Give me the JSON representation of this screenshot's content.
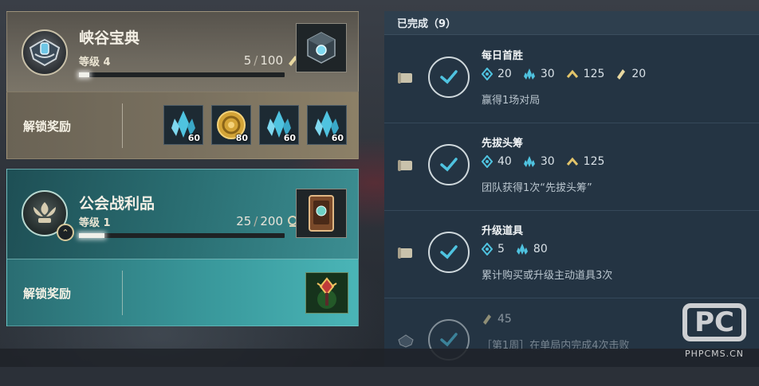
{
  "pass1": {
    "title": "峡谷宝典",
    "level": "等级 4",
    "progress_current": "5",
    "progress_sep": "/",
    "progress_total": "100",
    "progress_fraction": 0.05,
    "unlock_label": "解锁奖励",
    "rewards": [
      {
        "icon": "crystal-icon",
        "qty": "60"
      },
      {
        "icon": "gold-coin-icon",
        "qty": "80"
      },
      {
        "icon": "crystal-icon",
        "qty": "60"
      },
      {
        "icon": "crystal-icon",
        "qty": "60"
      }
    ]
  },
  "pass2": {
    "title": "公会战利品",
    "level": "等级 1",
    "progress_current": "25",
    "progress_sep": "/",
    "progress_total": "200",
    "progress_fraction": 0.125,
    "unlock_label": "解锁奖励"
  },
  "completed": {
    "header": "已完成（9）",
    "missions": [
      {
        "title": "每日首胜",
        "rewards": [
          {
            "icon": "blue-gem-icon",
            "value": "20"
          },
          {
            "icon": "blue-crystal-icon",
            "value": "30"
          },
          {
            "icon": "gold-chevron-icon",
            "value": "125"
          },
          {
            "icon": "gold-ticket-icon",
            "value": "20"
          }
        ],
        "desc": "赢得1场对局"
      },
      {
        "title": "先拔头筹",
        "rewards": [
          {
            "icon": "blue-gem-icon",
            "value": "40"
          },
          {
            "icon": "blue-crystal-icon",
            "value": "30"
          },
          {
            "icon": "gold-chevron-icon",
            "value": "125"
          }
        ],
        "desc": "团队获得1次“先拔头筹”"
      },
      {
        "title": "升级道具",
        "rewards": [
          {
            "icon": "blue-gem-icon",
            "value": "5"
          },
          {
            "icon": "blue-crystal-icon",
            "value": "80"
          }
        ],
        "desc": "累计购买或升级主动道具3次"
      },
      {
        "title": "",
        "rewards": [
          {
            "icon": "gold-ticket-icon",
            "value": "45"
          }
        ],
        "desc": "［第1周］在单局内完成4次击败"
      }
    ]
  },
  "watermark": {
    "logo": "PC",
    "text": "PHPCMS.CN"
  },
  "colors": {
    "accent_teal": "#3c8e92",
    "gem_blue": "#4fc3e0",
    "gold": "#e2c46a"
  }
}
